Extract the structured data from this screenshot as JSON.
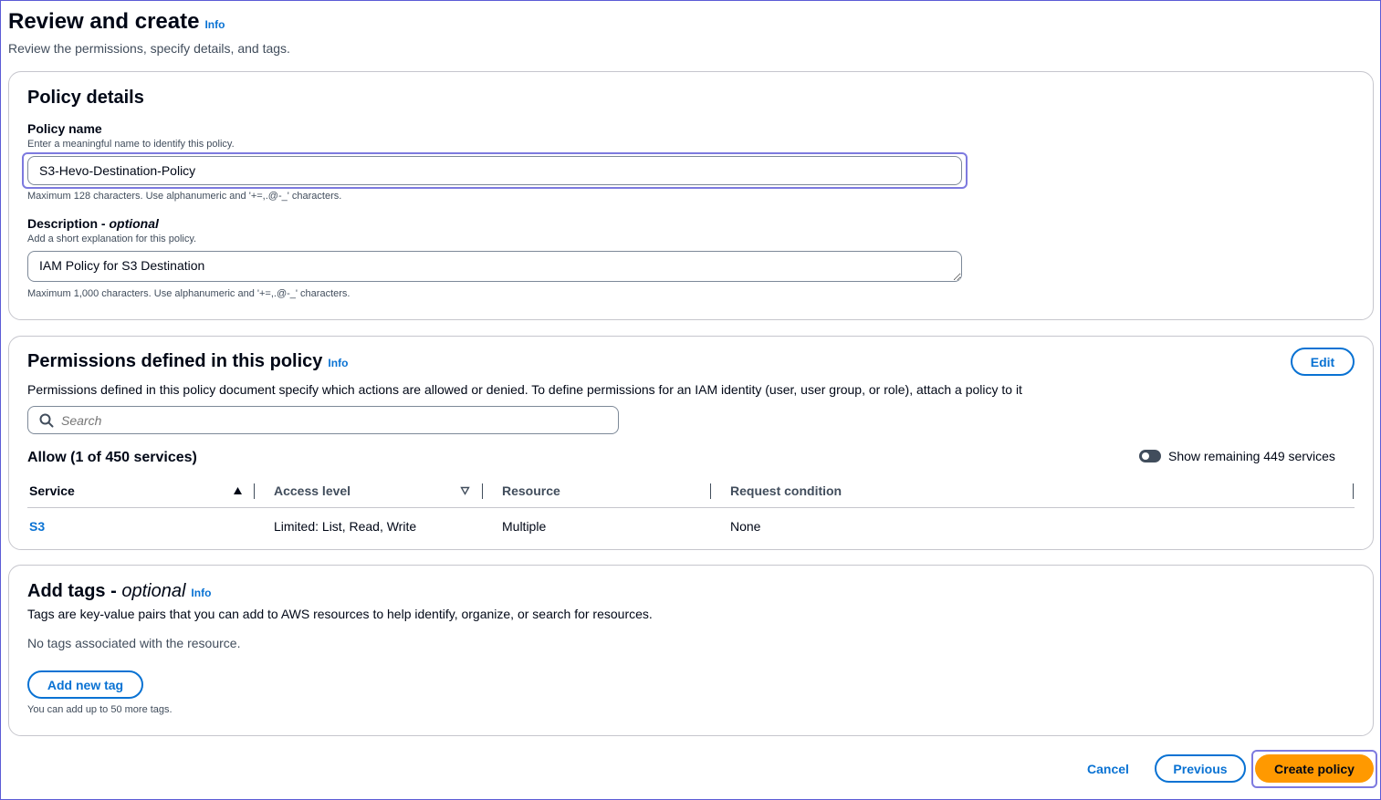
{
  "header": {
    "title": "Review and create",
    "info": "Info",
    "subtitle": "Review the permissions, specify details, and tags."
  },
  "policy_details": {
    "title": "Policy details",
    "name_label": "Policy name",
    "name_desc": "Enter a meaningful name to identify this policy.",
    "name_value": "S3-Hevo-Destination-Policy",
    "name_constraint": "Maximum 128 characters. Use alphanumeric and '+=,.@-_' characters.",
    "desc_label": "Description - ",
    "desc_label_optional": "optional",
    "desc_desc": "Add a short explanation for this policy.",
    "desc_value": "IAM Policy for S3 Destination",
    "desc_constraint": "Maximum 1,000 characters. Use alphanumeric and '+=,.@-_' characters."
  },
  "permissions": {
    "title": "Permissions defined in this policy",
    "info": "Info",
    "edit_label": "Edit",
    "description": "Permissions defined in this policy document specify which actions are allowed or denied. To define permissions for an IAM identity (user, user group, or role), attach a policy to it",
    "search_placeholder": "Search",
    "allow_heading": "Allow (1 of 450 services)",
    "toggle_label": "Show remaining 449 services",
    "columns": [
      "Service",
      "Access level",
      "Resource",
      "Request condition"
    ],
    "rows": [
      {
        "service": "S3",
        "access_level": "Limited: List, Read, Write",
        "resource": "Multiple",
        "request_condition": "None"
      }
    ]
  },
  "tags": {
    "title": "Add tags - ",
    "title_optional": "optional",
    "info": "Info",
    "description": "Tags are key-value pairs that you can add to AWS resources to help identify, organize, or search for resources.",
    "empty": "No tags associated with the resource.",
    "add_label": "Add new tag",
    "limit_note": "You can add up to 50 more tags."
  },
  "footer": {
    "cancel": "Cancel",
    "previous": "Previous",
    "create": "Create policy"
  }
}
